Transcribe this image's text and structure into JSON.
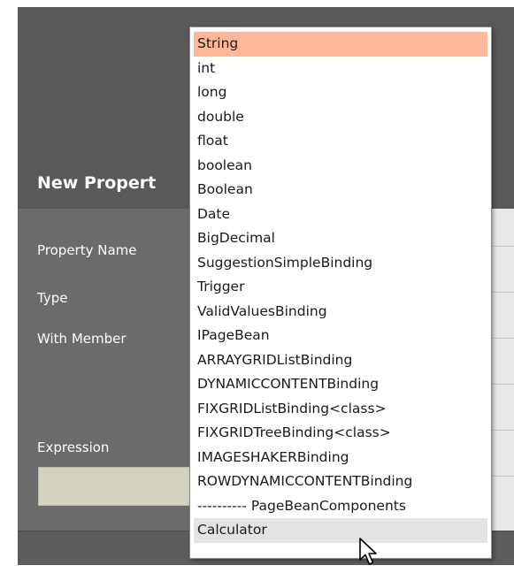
{
  "dialog": {
    "title": "New Propert",
    "fields": {
      "property_name": "Property Name",
      "type": "Type",
      "with_member": "With Member",
      "expression": "Expression"
    },
    "expression_value": ""
  },
  "type_dropdown": {
    "selected": "String",
    "hovered": "Calculator",
    "options": [
      "String",
      "int",
      "long",
      "double",
      "float",
      "boolean",
      "Boolean",
      "Date",
      "BigDecimal",
      "SuggestionSimpleBinding",
      "Trigger",
      "ValidValuesBinding",
      "IPageBean",
      "ARRAYGRIDListBinding",
      "DYNAMICCONTENTBinding",
      "FIXGRIDListBinding<class>",
      "FIXGRIDTreeBinding<class>",
      "IMAGESHAKERBinding",
      "ROWDYNAMICCONTENTBinding",
      "---------- PageBeanComponents",
      "Calculator"
    ]
  },
  "colors": {
    "dialog_header": "#595959",
    "dialog_body": "#6b6b6b",
    "selected_option": "#ffb899",
    "hovered_option": "#e3e3e3",
    "expression_field": "#d3d2c0"
  },
  "icons": {
    "cursor": "mouse-pointer-icon"
  }
}
